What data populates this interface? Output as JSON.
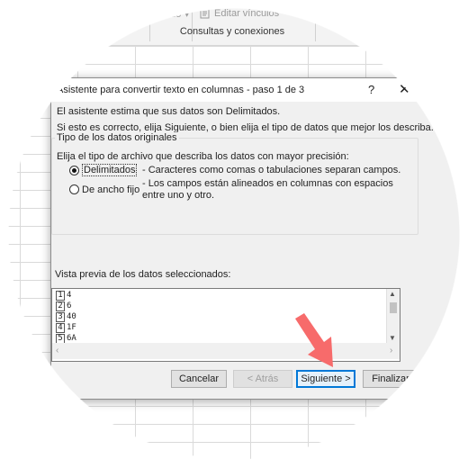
{
  "ribbon": {
    "item_todo": "todo",
    "item_edit_links": "Editar vínculos",
    "group_label": "Consultas y conexiones"
  },
  "dialog": {
    "title": "Asistente para convertir texto en columnas - paso 1 de 3",
    "help_glyph": "?",
    "close_glyph": "✕",
    "line1": "El asistente estima que sus datos son Delimitados.",
    "line2": "Si esto es correcto, elija Siguiente, o bien elija el tipo de datos que mejor los describa.",
    "group_title": "Tipo de los datos originales",
    "group_prompt": "Elija el tipo de archivo que describa los datos con mayor precisión:",
    "options": [
      {
        "label": "Delimitados",
        "description": "- Caracteres como comas o tabulaciones separan campos.",
        "selected": true
      },
      {
        "label": "De ancho fijo",
        "description": "- Los campos están alineados en columnas con espacios entre uno y otro.",
        "selected": false
      }
    ],
    "preview_label": "Vista previa de los datos seleccionados:",
    "preview_rows": [
      {
        "n": "1",
        "v": "4"
      },
      {
        "n": "2",
        "v": "6"
      },
      {
        "n": "3",
        "v": "40"
      },
      {
        "n": "4",
        "v": "1F"
      },
      {
        "n": "5",
        "v": "6A"
      }
    ],
    "buttons": {
      "cancel": "Cancelar",
      "back": "< Atrás",
      "next": "Siguiente >",
      "finish": "Finalizar"
    }
  },
  "colors": {
    "accent": "#0078d7",
    "arrow": "#f76b6b"
  }
}
